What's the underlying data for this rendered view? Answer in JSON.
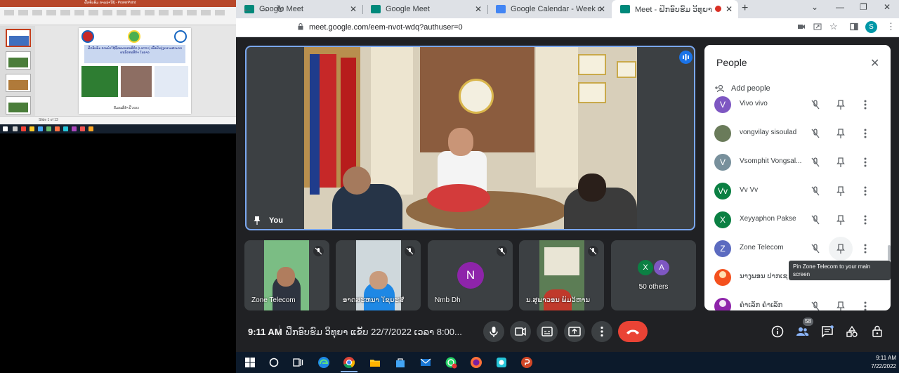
{
  "ppt": {
    "window_title": "ຝຶກອົບຮົມ ການນຳໃຊ້ - PowerPoint",
    "slide_title": "ຝຶກອົບຮົມ ການນຳໃຊ້ຊີວະພາບກະສິກຳ (LaCSA) ເພື່ອປັບປຸງຄວາມສາມາດຜະລິດກະສິກຳ ໃນລາວ",
    "slide_footer": "ກົມກະສິກຳ ປີ 2022",
    "status": "Slide 1 of 13"
  },
  "tabs": [
    {
      "label": "Google Meet",
      "favicon_color": "#00897b"
    },
    {
      "label": "Google Meet",
      "favicon_color": "#00897b"
    },
    {
      "label": "Google Calendar - Week of July ...",
      "favicon_color": "#4285f4"
    },
    {
      "label": "Meet - ຝຶກອົບຮົມ ວິທຸຍາ ແຂັບ",
      "favicon_color": "#00897b"
    }
  ],
  "address": {
    "url": "meet.google.com/eem-nvot-wdq?authuser=0"
  },
  "profile_initial": "S",
  "main_tile": {
    "label": "You"
  },
  "tiles": [
    {
      "name": "Zone Telecom"
    },
    {
      "name": "ອາດສະຫນາ ໃຊຍະສີ"
    },
    {
      "name": "Nmb Dh",
      "initial": "N",
      "color": "#8e24aa"
    },
    {
      "name": "ນ.ສຸພາວອນ ພົມວິຫານ"
    },
    {
      "name": "50 others",
      "initials": [
        "X",
        "A"
      ],
      "colors": [
        "#0b8043",
        "#7e57c2"
      ]
    }
  ],
  "bottom": {
    "time": "9:11 AM",
    "meeting_name": "ຝຶກອົບຮົມ ວິທຸຍາ ແຂັບ 22/7/2022 ເວລາ 8:00...",
    "participant_count": "58"
  },
  "people": {
    "title": "People",
    "add_people": "Add people",
    "rows": [
      {
        "name": "Vivo vivo",
        "initial": "V",
        "color": "#7e57c2"
      },
      {
        "name": "vongvilay sisoulad",
        "initial": "",
        "color": "#6a7b5a"
      },
      {
        "name": "Vsomphit Vongsal...",
        "initial": "V",
        "color": "#78909c"
      },
      {
        "name": "Vv Vv",
        "initial": "Vv",
        "color": "#0b8043"
      },
      {
        "name": "Xeyyaphon Pakse",
        "initial": "X",
        "color": "#0b8043"
      },
      {
        "name": "Zone Telecom",
        "initial": "Z",
        "color": "#5c6bc0"
      },
      {
        "name": "ນາງພອນ ປາກເຊ",
        "initial": "",
        "color": "#f4511e"
      },
      {
        "name": "ຄຳເລັກ ຄຳເລັກ",
        "initial": "",
        "color": "#8e24aa"
      }
    ],
    "tooltip": "Pin Zone Telecom to your main screen"
  },
  "taskbar": {
    "time": "9:11 AM",
    "date": "7/22/2022"
  }
}
